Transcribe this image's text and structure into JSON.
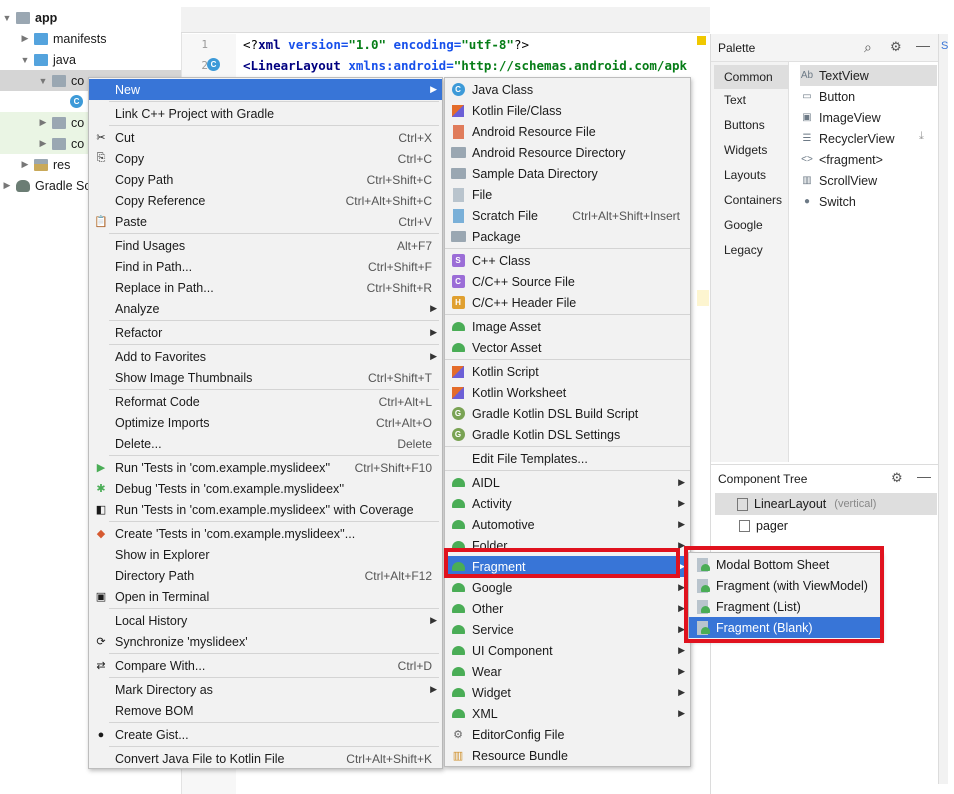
{
  "project_tree": [
    {
      "label": "app",
      "arrow": "▼",
      "icon": "folder",
      "level": 0
    },
    {
      "label": "manifests",
      "arrow": "▶",
      "icon": "folder-blue",
      "level": 1
    },
    {
      "label": "java",
      "arrow": "▼",
      "icon": "folder-blue",
      "level": 1
    },
    {
      "label": "co",
      "arrow": "▼",
      "icon": "folder",
      "level": 2
    },
    {
      "label": "",
      "arrow": "",
      "icon": "class",
      "level": 3
    },
    {
      "label": "co",
      "arrow": "▶",
      "icon": "folder",
      "level": 2
    },
    {
      "label": "co",
      "arrow": "▶",
      "icon": "folder",
      "level": 2
    },
    {
      "label": "res",
      "arrow": "▶",
      "icon": "folder-res",
      "level": 1
    },
    {
      "label": "Gradle Sc",
      "arrow": "▶",
      "icon": "gradle",
      "level": 0
    }
  ],
  "editor": {
    "line_numbers": [
      "1",
      "2"
    ],
    "line1": {
      "open": "<?",
      "tag": "xml",
      "attr1": " version=",
      "val1": "\"1.0\"",
      "attr2": " encoding=",
      "val2": "\"utf-8\"",
      "close": "?>"
    },
    "line2": {
      "tag": "<LinearLayout",
      "attr": " xmlns:android=",
      "val": "\"http://schemas.android.com/apk"
    }
  },
  "palette": {
    "title": "Palette",
    "categories": [
      "Common",
      "Text",
      "Buttons",
      "Widgets",
      "Layouts",
      "Containers",
      "Google",
      "Legacy"
    ],
    "selected_category": "Common",
    "items": [
      {
        "icon": "Ab",
        "label": "TextView"
      },
      {
        "icon": "▭",
        "label": "Button"
      },
      {
        "icon": "▣",
        "label": "ImageView"
      },
      {
        "icon": "☰",
        "label": "RecyclerView"
      },
      {
        "icon": "<>",
        "label": "<fragment>"
      },
      {
        "icon": "▥",
        "label": "ScrollView"
      },
      {
        "icon": "●",
        "label": "Switch"
      }
    ]
  },
  "component_tree": {
    "title": "Component Tree",
    "root": "LinearLayout",
    "root_hint": "(vertical)",
    "child": "pager"
  },
  "context_menu": [
    {
      "label": "New",
      "sc": "",
      "sub": true,
      "icon": "",
      "selected": true
    },
    {
      "sep": true
    },
    {
      "label": "Link C++ Project with Gradle",
      "sc": "",
      "icon": ""
    },
    {
      "sep": true
    },
    {
      "label": "Cut",
      "sc": "Ctrl+X",
      "icon": "✂"
    },
    {
      "label": "Copy",
      "sc": "Ctrl+C",
      "icon": "⎘"
    },
    {
      "label": "Copy Path",
      "sc": "Ctrl+Shift+C",
      "icon": ""
    },
    {
      "label": "Copy Reference",
      "sc": "Ctrl+Alt+Shift+C",
      "icon": ""
    },
    {
      "label": "Paste",
      "sc": "Ctrl+V",
      "icon": "📋"
    },
    {
      "sep": true
    },
    {
      "label": "Find Usages",
      "sc": "Alt+F7",
      "icon": ""
    },
    {
      "label": "Find in Path...",
      "sc": "Ctrl+Shift+F",
      "icon": ""
    },
    {
      "label": "Replace in Path...",
      "sc": "Ctrl+Shift+R",
      "icon": ""
    },
    {
      "label": "Analyze",
      "sc": "",
      "sub": true,
      "icon": ""
    },
    {
      "sep": true
    },
    {
      "label": "Refactor",
      "sc": "",
      "sub": true,
      "icon": ""
    },
    {
      "sep": true
    },
    {
      "label": "Add to Favorites",
      "sc": "",
      "sub": true,
      "icon": ""
    },
    {
      "label": "Show Image Thumbnails",
      "sc": "Ctrl+Shift+T",
      "icon": ""
    },
    {
      "sep": true
    },
    {
      "label": "Reformat Code",
      "sc": "Ctrl+Alt+L",
      "icon": ""
    },
    {
      "label": "Optimize Imports",
      "sc": "Ctrl+Alt+O",
      "icon": ""
    },
    {
      "label": "Delete...",
      "sc": "Delete",
      "icon": ""
    },
    {
      "sep": true
    },
    {
      "label": "Run 'Tests in 'com.example.myslideex''",
      "sc": "Ctrl+Shift+F10",
      "icon": "▶"
    },
    {
      "label": "Debug 'Tests in 'com.example.myslideex''",
      "sc": "",
      "icon": "🐞"
    },
    {
      "label": "Run 'Tests in 'com.example.myslideex'' with Coverage",
      "sc": "",
      "icon": "◧"
    },
    {
      "sep": true
    },
    {
      "label": "Create 'Tests in 'com.example.myslideex''...",
      "sc": "",
      "icon": "◆"
    },
    {
      "label": "Show in Explorer",
      "sc": "",
      "icon": ""
    },
    {
      "label": "Directory Path",
      "sc": "Ctrl+Alt+F12",
      "icon": ""
    },
    {
      "label": "Open in Terminal",
      "sc": "",
      "icon": "▣"
    },
    {
      "sep": true
    },
    {
      "label": "Local History",
      "sc": "",
      "sub": true,
      "icon": ""
    },
    {
      "label": "Synchronize 'myslideex'",
      "sc": "",
      "icon": "⟳"
    },
    {
      "sep": true
    },
    {
      "label": "Compare With...",
      "sc": "Ctrl+D",
      "icon": "⇄"
    },
    {
      "sep": true
    },
    {
      "label": "Mark Directory as",
      "sc": "",
      "sub": true,
      "icon": ""
    },
    {
      "label": "Remove BOM",
      "sc": "",
      "icon": ""
    },
    {
      "sep": true
    },
    {
      "label": "Create Gist...",
      "sc": "",
      "icon": "●"
    },
    {
      "sep": true
    },
    {
      "label": "Convert Java File to Kotlin File",
      "sc": "Ctrl+Alt+Shift+K",
      "icon": ""
    }
  ],
  "new_menu": [
    {
      "label": "Java Class",
      "icon": "blue-c",
      "sc": ""
    },
    {
      "label": "Kotlin File/Class",
      "icon": "kotlin",
      "sc": ""
    },
    {
      "label": "Android Resource File",
      "icon": "xml",
      "sc": ""
    },
    {
      "label": "Android Resource Directory",
      "icon": "folder",
      "sc": ""
    },
    {
      "label": "Sample Data Directory",
      "icon": "folder",
      "sc": ""
    },
    {
      "label": "File",
      "icon": "file",
      "sc": ""
    },
    {
      "label": "Scratch File",
      "icon": "scratch",
      "sc": "Ctrl+Alt+Shift+Insert"
    },
    {
      "label": "Package",
      "icon": "folder",
      "sc": ""
    },
    {
      "sep": true
    },
    {
      "label": "C++ Class",
      "icon": "cpp-s",
      "sc": ""
    },
    {
      "label": "C/C++ Source File",
      "icon": "cpp",
      "sc": ""
    },
    {
      "label": "C/C++ Header File",
      "icon": "h",
      "sc": ""
    },
    {
      "sep": true
    },
    {
      "label": "Image Asset",
      "icon": "android",
      "sc": ""
    },
    {
      "label": "Vector Asset",
      "icon": "android",
      "sc": ""
    },
    {
      "sep": true
    },
    {
      "label": "Kotlin Script",
      "icon": "kotlin",
      "sc": ""
    },
    {
      "label": "Kotlin Worksheet",
      "icon": "kotlin",
      "sc": ""
    },
    {
      "label": "Gradle Kotlin DSL Build Script",
      "icon": "gradle",
      "sc": ""
    },
    {
      "label": "Gradle Kotlin DSL Settings",
      "icon": "gradle",
      "sc": ""
    },
    {
      "sep": true
    },
    {
      "label": "Edit File Templates...",
      "icon": "",
      "sc": ""
    },
    {
      "sep": true
    },
    {
      "label": "AIDL",
      "icon": "android",
      "sub": true
    },
    {
      "label": "Activity",
      "icon": "android",
      "sub": true
    },
    {
      "label": "Automotive",
      "icon": "android",
      "sub": true
    },
    {
      "label": "Folder",
      "icon": "android",
      "sub": true
    },
    {
      "label": "Fragment",
      "icon": "android",
      "sub": true,
      "selected": true
    },
    {
      "label": "Google",
      "icon": "android",
      "sub": true
    },
    {
      "label": "Other",
      "icon": "android",
      "sub": true
    },
    {
      "label": "Service",
      "icon": "android",
      "sub": true
    },
    {
      "label": "UI Component",
      "icon": "android",
      "sub": true
    },
    {
      "label": "Wear",
      "icon": "android",
      "sub": true
    },
    {
      "label": "Widget",
      "icon": "android",
      "sub": true
    },
    {
      "label": "XML",
      "icon": "android",
      "sub": true
    },
    {
      "label": "EditorConfig File",
      "icon": "gear",
      "sc": ""
    },
    {
      "label": "Resource Bundle",
      "icon": "bundle",
      "sc": ""
    }
  ],
  "fragment_menu": [
    {
      "label": "Modal Bottom Sheet"
    },
    {
      "label": "Fragment (with ViewModel)"
    },
    {
      "label": "Fragment (List)"
    },
    {
      "label": "Fragment (Blank)",
      "selected": true
    }
  ],
  "colors": {
    "selection": "#3875d7",
    "highlight": "#e0121e",
    "android_green": "#4aad56"
  }
}
